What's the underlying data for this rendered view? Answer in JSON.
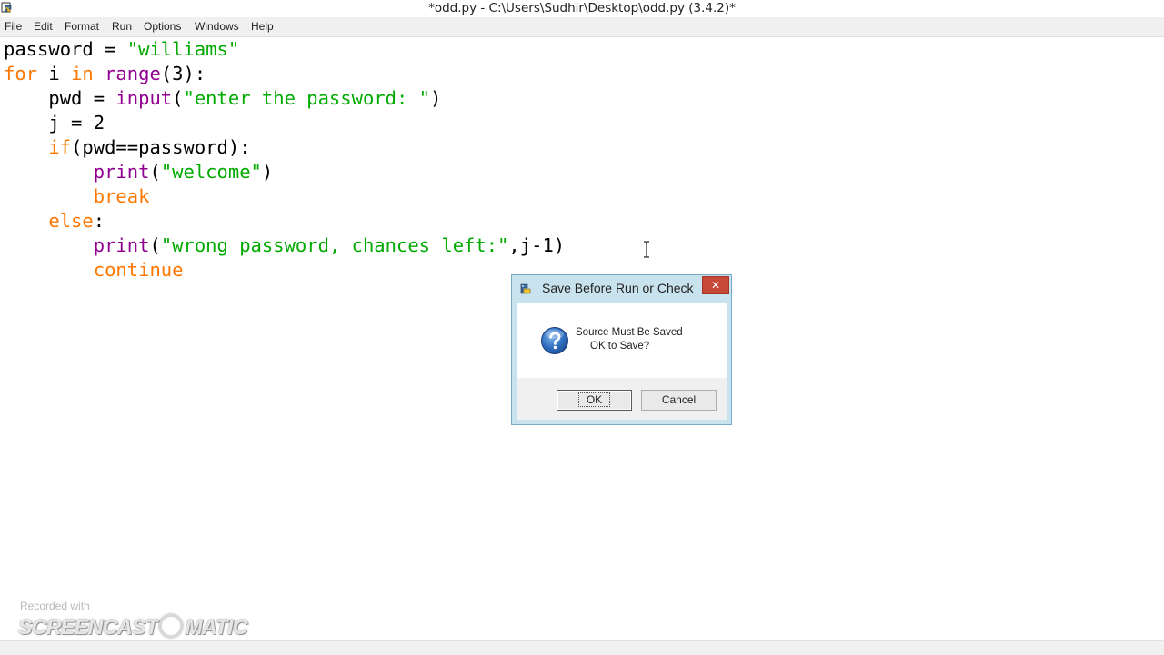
{
  "window": {
    "title": "*odd.py - C:\\Users\\Sudhir\\Desktop\\odd.py (3.4.2)*"
  },
  "menu": {
    "items": [
      "File",
      "Edit",
      "Format",
      "Run",
      "Options",
      "Windows",
      "Help"
    ]
  },
  "code": {
    "line1": {
      "a": "password = ",
      "b": "\"williams\""
    },
    "line2": {
      "a": "for",
      "b": " i ",
      "c": "in",
      "d": " ",
      "e": "range",
      "f": "(3):"
    },
    "line3": {
      "a": "    pwd = ",
      "b": "input",
      "c": "(",
      "d": "\"enter the password: \"",
      "e": ")"
    },
    "line4": {
      "a": "    j = 2"
    },
    "line5": {
      "a": "    ",
      "b": "if",
      "c": "(pwd==password):"
    },
    "line6": {
      "a": "        ",
      "b": "print",
      "c": "(",
      "d": "\"welcome\"",
      "e": ")"
    },
    "line7": {
      "a": "        ",
      "b": "break"
    },
    "line8": {
      "a": "    ",
      "b": "else",
      "c": ":"
    },
    "line9": {
      "a": "        ",
      "b": "print",
      "c": "(",
      "d": "\"wrong password, chances left:\"",
      "e": ",j-1)"
    },
    "line10": {
      "a": "        ",
      "b": "continue"
    }
  },
  "syntax_colors": {
    "keyword": "#ff7700",
    "builtin": "#900090",
    "string": "#00aa00"
  },
  "dialog": {
    "title": "Save Before Run or Check",
    "close_glyph": "✕",
    "message_line1": "Source Must Be Saved",
    "message_line2": "OK to Save?",
    "ok_label": "OK",
    "cancel_label": "Cancel",
    "icon": "question-icon"
  },
  "watermark": {
    "small": "Recorded with",
    "big_left": "SCREENCAST",
    "big_right": "MATIC"
  }
}
